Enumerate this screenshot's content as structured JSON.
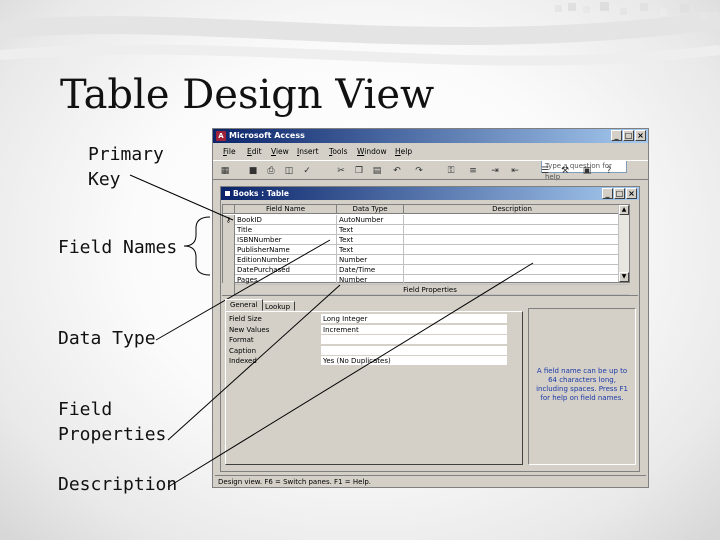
{
  "slide": {
    "title": "Table Design View",
    "labels": {
      "primary_key": [
        "Primary",
        "Key"
      ],
      "field_names": [
        "Field Names"
      ],
      "data_type": [
        "Data Type"
      ],
      "field_properties": [
        "Field",
        "Properties"
      ],
      "description": [
        "Description"
      ]
    }
  },
  "app": {
    "title": "Microsoft Access",
    "icon_letter": "A",
    "window_buttons": [
      "_",
      "□",
      "×"
    ],
    "menu": [
      "File",
      "Edit",
      "View",
      "Insert",
      "Tools",
      "Window",
      "Help"
    ],
    "ask_placeholder": "Type a question for help",
    "status_text": "Design view.  F6 = Switch panes.  F1 = Help."
  },
  "table_window": {
    "title": "Books : Table",
    "columns": [
      "Field Name",
      "Data Type",
      "Description"
    ],
    "rows": [
      {
        "field": "BookID",
        "type": "AutoNumber",
        "description": "",
        "key": true
      },
      {
        "field": "Title",
        "type": "Text",
        "description": ""
      },
      {
        "field": "ISBNNumber",
        "type": "Text",
        "description": ""
      },
      {
        "field": "PublisherName",
        "type": "Text",
        "description": ""
      },
      {
        "field": "EditionNumber",
        "type": "Number",
        "description": ""
      },
      {
        "field": "DatePurchased",
        "type": "Date/Time",
        "description": ""
      },
      {
        "field": "Pages",
        "type": "Number",
        "description": ""
      }
    ],
    "field_properties_label": "Field Properties",
    "tabs": [
      "General",
      "Lookup"
    ],
    "properties": [
      {
        "name": "Field Size",
        "value": "Long Integer"
      },
      {
        "name": "New Values",
        "value": "Increment"
      },
      {
        "name": "Format",
        "value": ""
      },
      {
        "name": "Caption",
        "value": ""
      },
      {
        "name": "Indexed",
        "value": "Yes (No Duplicates)"
      }
    ],
    "help_text": "A field name can be up to 64 characters long, including spaces.  Press F1 for help on field names."
  }
}
